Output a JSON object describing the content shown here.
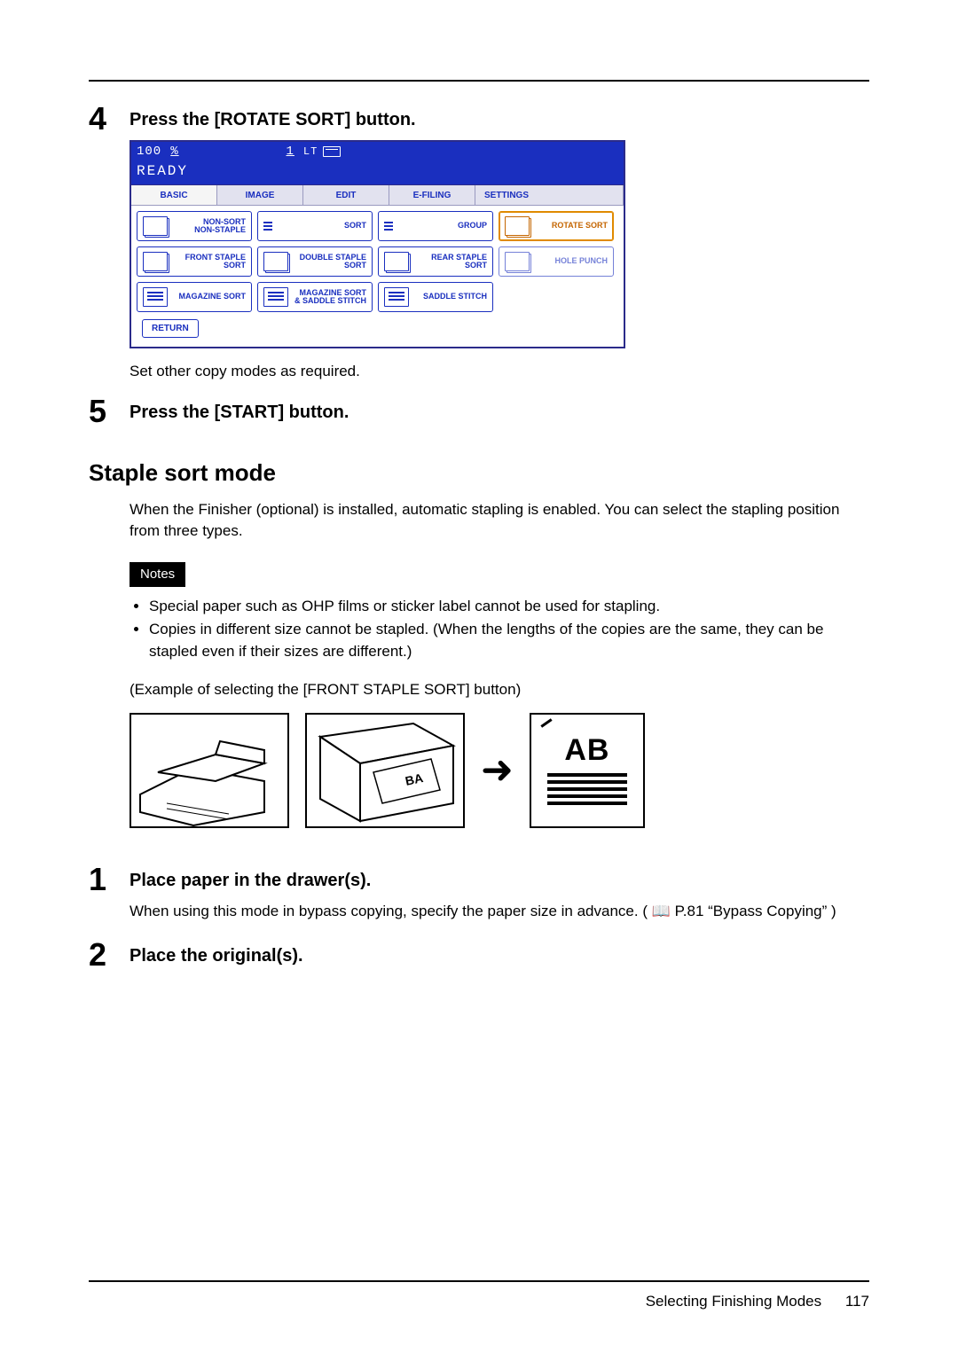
{
  "steps_a": {
    "s4": {
      "num": "4",
      "title": "Press the [ROTATE SORT] button."
    },
    "s4_after": "Set other copy modes as required.",
    "s5": {
      "num": "5",
      "title": "Press the [START] button."
    }
  },
  "panel": {
    "pct_num": "100",
    "pct_sym": "%",
    "copies": "1",
    "paper": "LT",
    "ready": "READY",
    "tabs": [
      "BASIC",
      "IMAGE",
      "EDIT",
      "E-FILING",
      "SETTINGS"
    ],
    "row1": [
      {
        "label": "NON-SORT\nNON-STAPLE"
      },
      {
        "label": "SORT"
      },
      {
        "label": "GROUP"
      },
      {
        "label": "ROTATE SORT",
        "selected": true
      }
    ],
    "row2": [
      {
        "label": "FRONT STAPLE\nSORT"
      },
      {
        "label": "DOUBLE STAPLE\nSORT"
      },
      {
        "label": "REAR STAPLE\nSORT"
      },
      {
        "label": "HOLE PUNCH",
        "dim": true
      }
    ],
    "row3": [
      {
        "label": "MAGAZINE SORT"
      },
      {
        "label": "MAGAZINE SORT\n& SADDLE STITCH"
      },
      {
        "label": "SADDLE STITCH"
      }
    ],
    "return": "RETURN"
  },
  "section": {
    "title": "Staple sort mode",
    "intro": "When the Finisher (optional) is installed, automatic stapling is enabled. You can select the stapling position from three types.",
    "notes_label": "Notes",
    "notes": [
      "Special paper such as OHP films or sticker label cannot be used for stapling.",
      "Copies in different size cannot be stapled. (When the lengths of the copies are the same, they can be stapled even if their sizes are different.)"
    ],
    "example": "(Example of selecting the [FRONT STAPLE SORT] button)",
    "ab": "AB"
  },
  "steps_b": {
    "s1": {
      "num": "1",
      "title": "Place paper in the drawer(s).",
      "body_a": "When using this mode in bypass copying, specify the paper size in advance. (",
      "ref": "P.81 “Bypass Copying”",
      "body_b": ")"
    },
    "s2": {
      "num": "2",
      "title": "Place the original(s)."
    }
  },
  "footer": {
    "title": "Selecting Finishing Modes",
    "page": "117"
  }
}
